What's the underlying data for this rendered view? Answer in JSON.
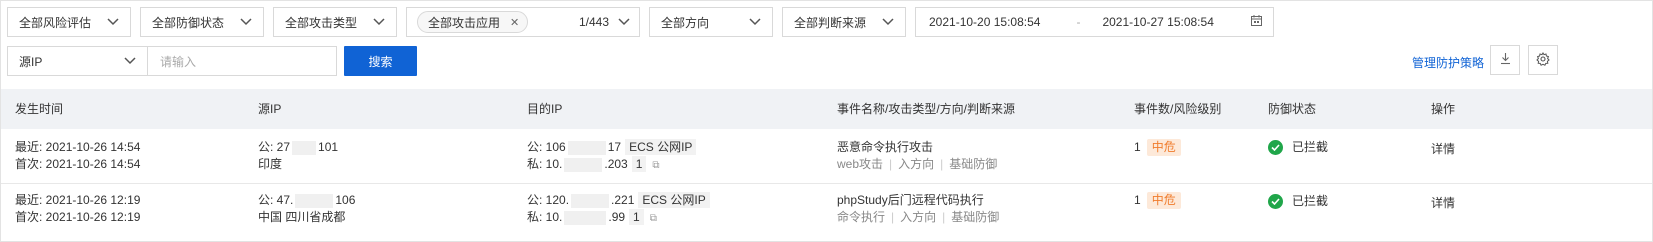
{
  "filters": {
    "risk": "全部风险评估",
    "defense": "全部防御状态",
    "attack_type": "全部攻击类型",
    "app_tag": "全部攻击应用",
    "app_count": "1/443",
    "direction": "全部方向",
    "source": "全部判断来源",
    "date_start": "2021-10-20 15:08:54",
    "date_sep": "-",
    "date_end": "2021-10-27 15:08:54",
    "ip_type": "源IP",
    "search_placeholder": "请输入",
    "search_button": "搜索",
    "manage_link": "管理防护策略"
  },
  "table": {
    "headers": [
      "发生时间",
      "源IP",
      "目的IP",
      "事件名称/攻击类型/方向/判断来源",
      "事件数/风险级别",
      "防御状态",
      "操作"
    ],
    "rows": [
      {
        "latest": "最近: 2021-10-26 14:54",
        "first": "首次: 2021-10-26 14:54",
        "src_pub_prefix": "公: 27",
        "src_pub_suffix": "101",
        "src_loc": "印度",
        "dst_pub_prefix": "公: 106",
        "dst_pub_suffix": "17",
        "dst_pub_chip": "ECS 公网IP",
        "dst_pri_prefix": "私: 10.",
        "dst_pri_suffix": ".203",
        "dst_pri_chip": "1",
        "event": "恶意命令执行攻击",
        "atype": "web攻击",
        "dir": "入方向",
        "src": "基础防御",
        "count": "1",
        "risk": "中危",
        "status": "已拦截",
        "action": "详情"
      },
      {
        "latest": "最近: 2021-10-26 12:19",
        "first": "首次: 2021-10-26 12:19",
        "src_pub_prefix": "公: 47.",
        "src_pub_suffix": "106",
        "src_loc": "中国 四川省成都",
        "dst_pub_prefix": "公: 120.",
        "dst_pub_suffix": ".221",
        "dst_pub_chip": "ECS 公网IP",
        "dst_pri_prefix": "私: 10.",
        "dst_pri_suffix": ".99",
        "dst_pri_chip": "1",
        "event": "phpStudy后门远程代码执行",
        "atype": "命令执行",
        "dir": "入方向",
        "src": "基础防御",
        "count": "1",
        "risk": "中危",
        "status": "已拦截",
        "action": "详情"
      }
    ]
  },
  "colors": {
    "primary": "#1063d5",
    "risk_bg": "#fde9d9",
    "risk_text": "#f07c2c",
    "success": "#20a64a",
    "header_bg": "#f0f2f5"
  },
  "icons": {
    "download": "download-icon",
    "settings": "gear-icon",
    "calendar": "calendar-icon",
    "copy": "copy-icon"
  }
}
